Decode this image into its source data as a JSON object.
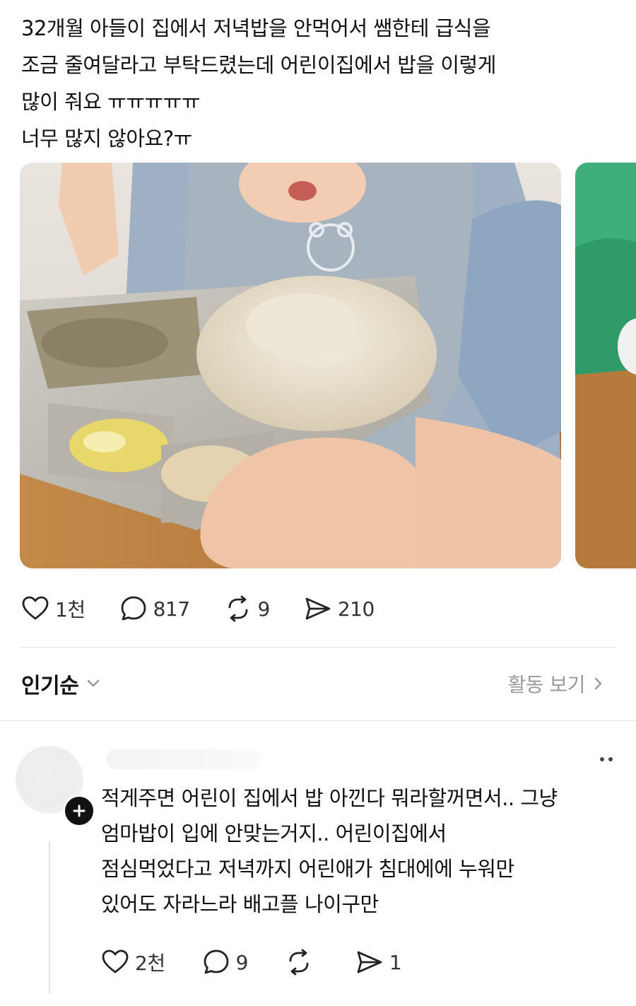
{
  "post": {
    "lines": [
      "32개월 아들이 집에서 저녁밥을 안먹어서 쌤한테 급식을",
      "조금 줄여달라고 부탁드렸는데 어린이집에서 밥을 이렇게",
      "많이 줘요 ㅠㅠㅠㅠㅠ",
      "너무 많지 않아요?ㅠ"
    ],
    "stats": {
      "likes": "1천",
      "comments": "817",
      "reposts": "9",
      "shares": "210"
    }
  },
  "sort": {
    "label": "인기순",
    "activity": "활동 보기"
  },
  "comment": {
    "lines": [
      "적게주면 어린이 집에서 밥 아낀다 뭐라할꺼면서.. 그냥",
      "엄마밥이 입에 안맞는거지.. 어린이집에서",
      "점심먹었다고 저녁까지 어린애가 침대에에  누워만",
      "있어도 자라느라 배고플 나이구만"
    ],
    "stats": {
      "likes": "2천",
      "comments": "9",
      "reposts": "",
      "shares": "1"
    }
  },
  "icons": {
    "like": "heart-icon",
    "comment": "speech-bubble-icon",
    "repost": "repost-icon",
    "share": "paper-plane-icon",
    "chevron": "chevron-down-icon",
    "more": "more-dots-icon",
    "follow": "plus-icon"
  },
  "colors": {
    "text": "#111111",
    "muted": "#9a9a9a",
    "divider": "#e6e6e6",
    "tray": "#b9b6ad"
  }
}
